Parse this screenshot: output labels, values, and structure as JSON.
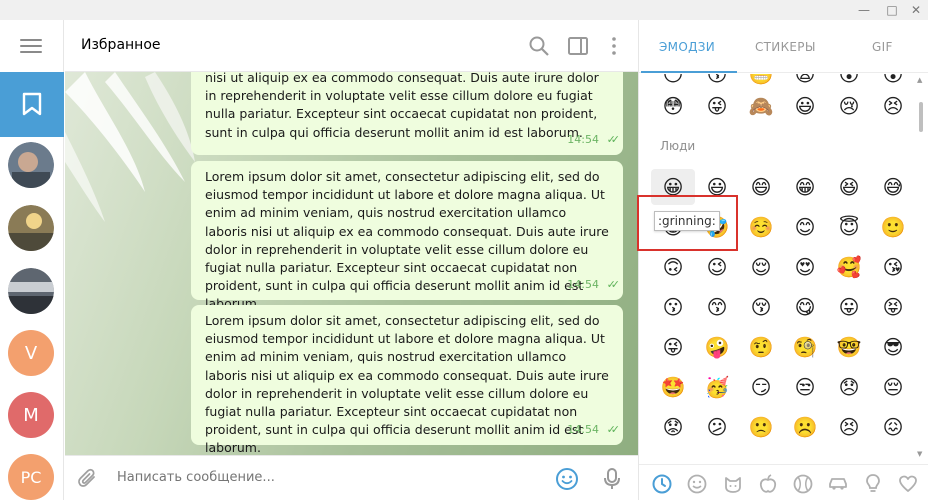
{
  "window": {
    "minimize": "—",
    "maximize": "□",
    "close": "✕"
  },
  "header": {
    "title": "Избранное"
  },
  "sidebar": {
    "avatars": [
      {
        "initials": "",
        "color": "#6b7b8c"
      },
      {
        "initials": "",
        "color": "#8a7b56"
      },
      {
        "initials": "",
        "color": "#5e6670"
      },
      {
        "initials": "V",
        "color": "#f3a06e"
      },
      {
        "initials": "M",
        "color": "#e06a6a"
      },
      {
        "initials": "PC",
        "color": "#f3a06e"
      }
    ]
  },
  "messages": [
    {
      "text": "nisi ut aliquip ex ea commodo consequat. Duis aute irure dolor in reprehenderit in voluptate velit esse cillum dolore eu fugiat nulla pariatur. Excepteur sint occaecat cupidatat non proident, sunt in culpa qui officia deserunt mollit anim id est laborum.",
      "time": "14:54"
    },
    {
      "text": "Lorem ipsum dolor sit amet, consectetur adipiscing elit, sed do eiusmod tempor incididunt ut labore et dolore magna aliqua. Ut enim ad minim veniam, quis nostrud exercitation ullamco laboris nisi ut aliquip ex ea commodo consequat. Duis aute irure dolor in reprehenderit in voluptate velit esse cillum dolore eu fugiat nulla pariatur. Excepteur sint occaecat cupidatat non proident, sunt in culpa qui officia deserunt mollit anim id est laborum.",
      "time": "14:54"
    },
    {
      "text": "Lorem ipsum dolor sit amet, consectetur adipiscing elit, sed do eiusmod tempor incididunt ut labore et dolore magna aliqua. Ut enim ad minim veniam, quis nostrud exercitation ullamco laboris nisi ut aliquip ex ea commodo consequat. Duis aute irure dolor in reprehenderit in voluptate velit esse cillum dolore eu fugiat nulla pariatur. Excepteur sint occaecat cupidatat non proident, sunt in culpa qui officia deserunt mollit anim id est laborum.",
      "time": "14:54"
    }
  ],
  "input": {
    "placeholder": "Написать сообщение..."
  },
  "emoji_panel": {
    "tabs": [
      "ЭМОДЗИ",
      "СТИКЕРЫ",
      "GIF"
    ],
    "section_people": "Люди",
    "tooltip": ":grinning:",
    "rows": [
      [
        "😳",
        "😜",
        "🙈",
        "😃",
        "😢",
        "😣"
      ],
      [
        "😀",
        "😃",
        "😄",
        "😁",
        "😆",
        "😅"
      ],
      [
        "😂",
        "🤣",
        "☺️",
        "😊",
        "😇",
        "🙂"
      ],
      [
        "🙃",
        "😉",
        "😌",
        "😍",
        "🥰",
        "😘"
      ],
      [
        "😗",
        "😙",
        "😚",
        "😋",
        "😛",
        "😝"
      ],
      [
        "😜",
        "🤪",
        "🤨",
        "🧐",
        "🤓",
        "😎"
      ],
      [
        "🤩",
        "🥳",
        "😏",
        "😒",
        "😞",
        "😔"
      ],
      [
        "😟",
        "😕",
        "🙁",
        "☹️",
        "😣",
        "😖"
      ]
    ]
  }
}
